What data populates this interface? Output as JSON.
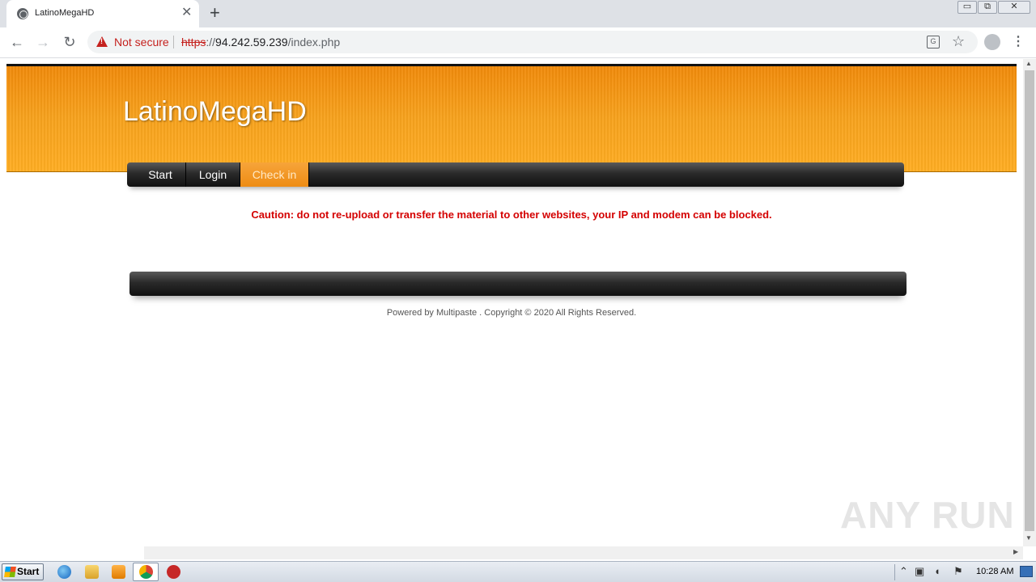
{
  "browser": {
    "tab_title": "LatinoMegaHD",
    "tab_close": "✕",
    "new_tab": "+",
    "window_controls": {
      "minimize": "▭",
      "restore": "⧉",
      "close": "✕"
    },
    "nav": {
      "back": "←",
      "forward": "→",
      "reload": "↻"
    },
    "security_label": "Not secure",
    "url_scheme": "https",
    "url_sep": "://",
    "url_host": "94.242.59.239",
    "url_path": "/index.php",
    "star": "☆",
    "menu": "⋮",
    "translate": "G"
  },
  "site": {
    "title": "LatinoMegaHD",
    "nav_items": [
      "Start",
      "Login",
      "Check in"
    ],
    "active_nav": "Check in",
    "caution": "Caution: do not re-upload or transfer the material to other websites, your IP and modem can be blocked.",
    "copyright": "Powered by Multipaste . Copyright © 2020 All Rights Reserved."
  },
  "colors": {
    "banner_orange": "#f7a21d",
    "caution_red": "#d40000",
    "nav_dark": "#1a1a1a",
    "active_orange": "#ee8c14"
  },
  "watermark": "ANY RUN",
  "taskbar": {
    "start_label": "Start",
    "clock": "10:28 AM",
    "icons": [
      "ie-icon",
      "explorer-icon",
      "media-player-icon",
      "chrome-icon",
      "stop-icon"
    ]
  }
}
